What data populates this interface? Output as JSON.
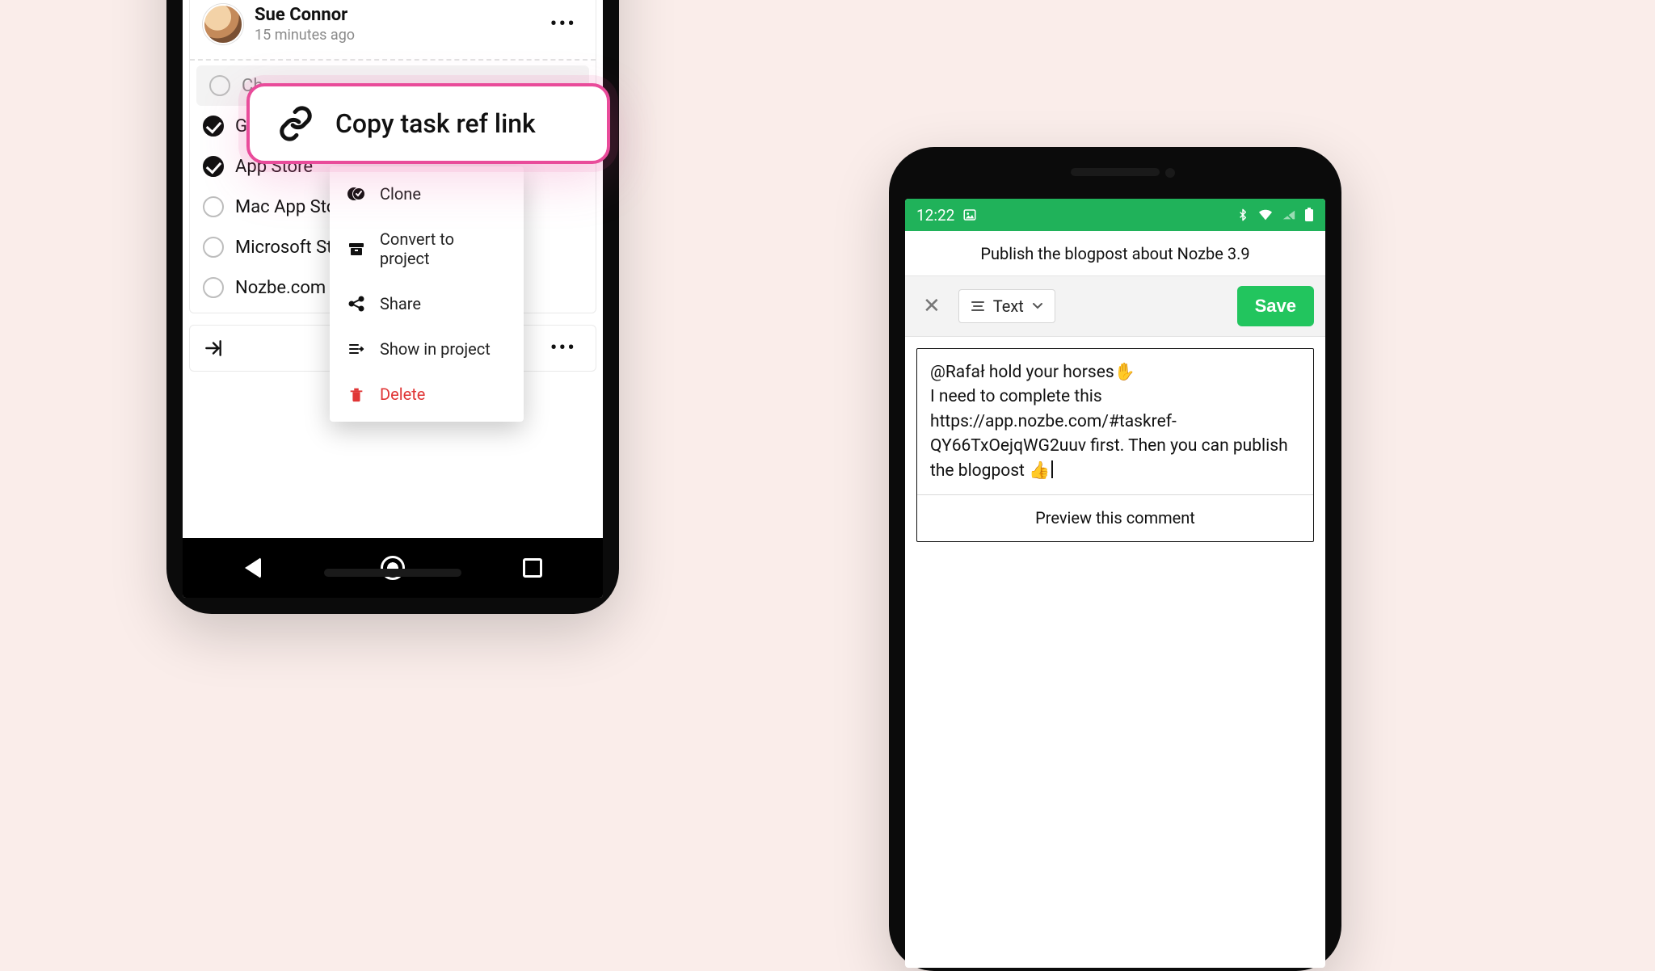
{
  "left": {
    "author": "Sue Connor",
    "time": "15 minutes ago",
    "checklist": [
      {
        "label": "Ch",
        "done": false,
        "highlight": true
      },
      {
        "label": "Go",
        "done": true
      },
      {
        "label": "App Store",
        "done": true
      },
      {
        "label": "Mac App Store",
        "done": false
      },
      {
        "label": "Microsoft Store",
        "done": false
      },
      {
        "label": "Nozbe.com",
        "done": false
      }
    ],
    "menu": {
      "clone": "Clone",
      "convert": "Convert to project",
      "share": "Share",
      "show": "Show in project",
      "delete": "Delete"
    },
    "callout": "Copy task ref link"
  },
  "right": {
    "status_time": "12:22",
    "appbar_title": "Publish the blogpost about Nozbe 3.9",
    "toolbar": {
      "select_label": "Text",
      "save_label": "Save"
    },
    "comment_text": "@Rafał hold your horses✋\nI need to complete this https://app.nozbe.com/#taskref-QY66TxOejqWG2uuv first. Then you can publish the blogpost 👍",
    "preview_label": "Preview this comment"
  }
}
